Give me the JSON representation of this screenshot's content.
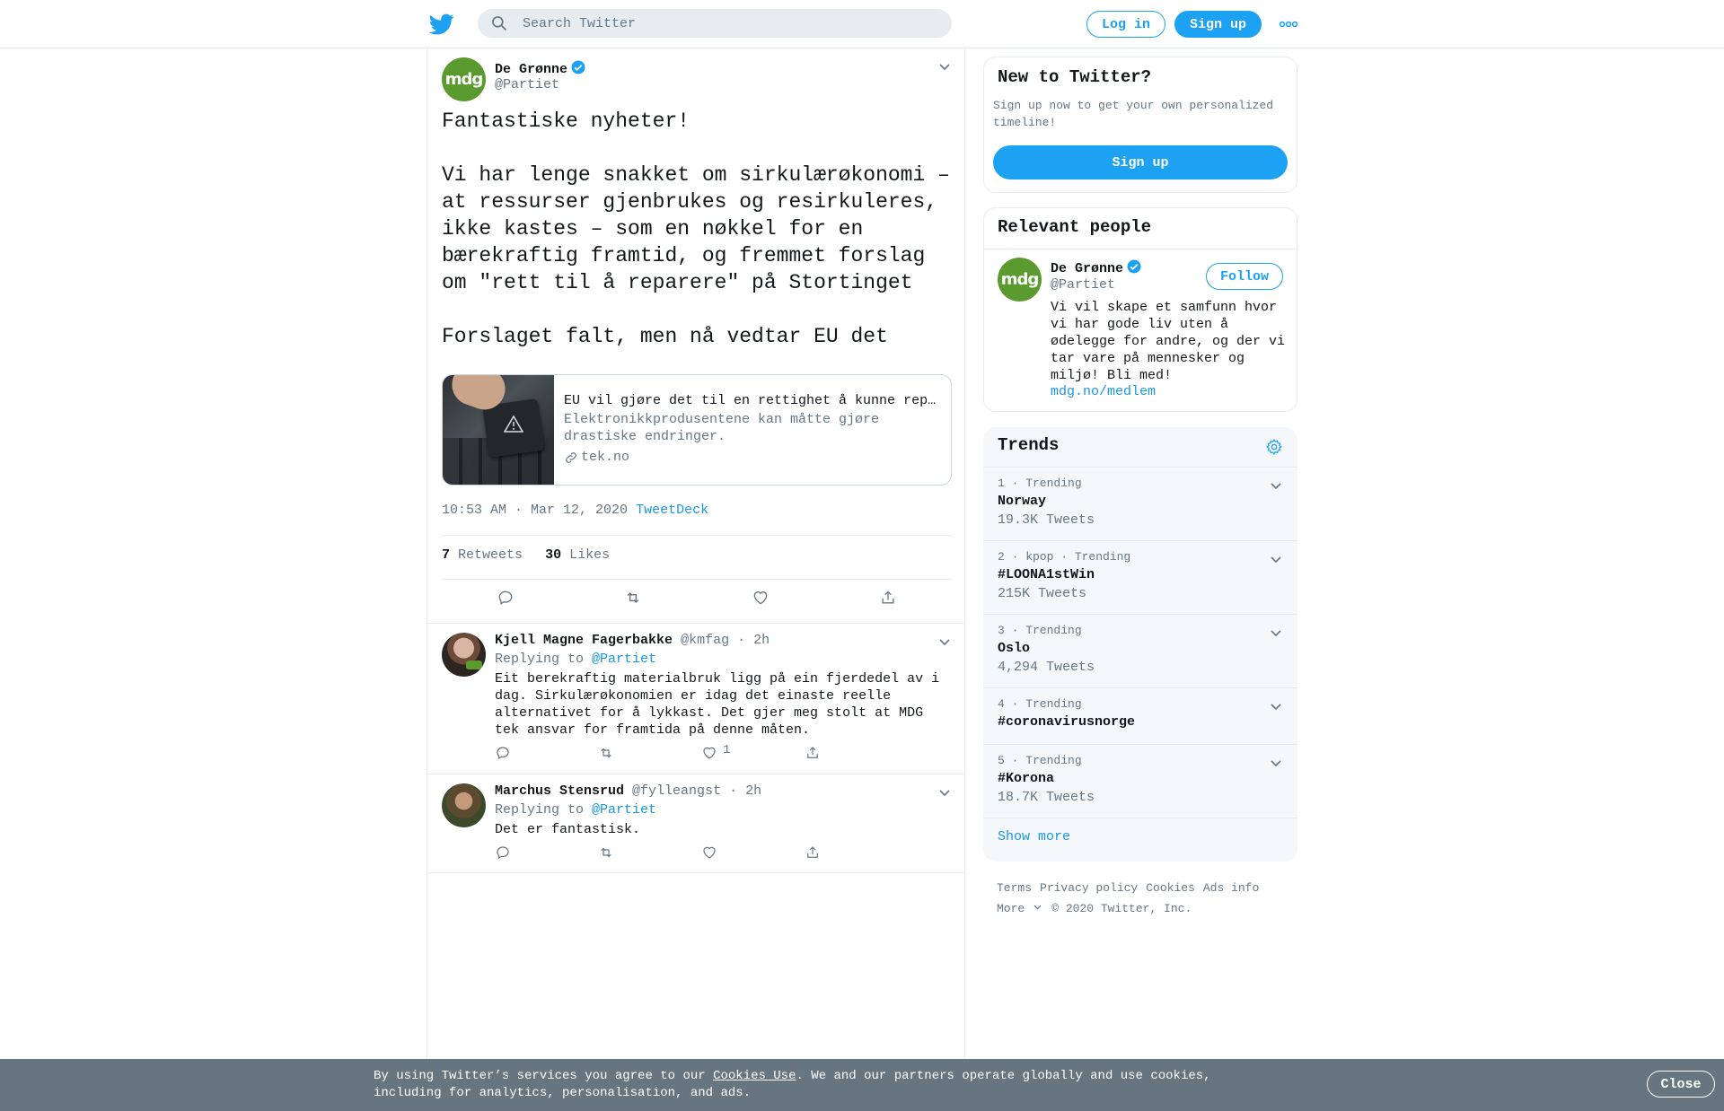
{
  "topbar": {
    "search_placeholder": "Search Twitter",
    "login_label": "Log in",
    "signup_label": "Sign up",
    "more_icon": "more-horizontal-icon"
  },
  "tweet": {
    "avatar_text": "mdg",
    "name": "De Grønne",
    "handle": "@Partiet",
    "text": "Fantastiske nyheter!\n\nVi har lenge snakket om sirkulærøkonomi – at ressurser gjenbrukes og resirkuleres, ikke kastes – som en nøkkel for en bærekraftig framtid, og fremmet forslag om \"rett til å reparere\" på Stortinget\n\nForslaget falt, men nå vedtar EU det",
    "card": {
      "title": "EU vil gjøre det til en rettighet å kunne reparere",
      "description": "Elektronikkprodusentene kan måtte gjøre drastiske endringer.",
      "domain": "tek.no"
    },
    "time": "10:53 AM · Mar 12, 2020",
    "time_sep": "·",
    "source": "TweetDeck",
    "retweets": "7",
    "retweets_label": "Retweets",
    "likes": "30",
    "likes_label": "Likes"
  },
  "replies": [
    {
      "name": "Kjell Magne Fagerbakke",
      "handle": "@kmfag",
      "sep": "·",
      "time": "2h",
      "replying_label": "Replying to",
      "replying_handle": "@Partiet",
      "text": "Eit berekraftig materialbruk ligg på ein fjerdedel av i dag. Sirkulærøkonomien er idag det einaste reelle alternativet for å lykkast. Det gjer meg stolt at MDG tek ansvar for framtida på denne måten.",
      "like_count": "1"
    },
    {
      "name": "Marchus Stensrud",
      "handle": "@fylleangst",
      "sep": "·",
      "time": "2h",
      "replying_label": "Replying to",
      "replying_handle": "@Partiet",
      "text": "Det er fantastisk.",
      "like_count": ""
    }
  ],
  "sidebar": {
    "new_title": "New to Twitter?",
    "new_text": "Sign up now to get your own personalized timeline!",
    "new_signup": "Sign up",
    "relevant_title": "Relevant people",
    "person": {
      "avatar_text": "mdg",
      "name": "De Grønne",
      "handle": "@Partiet",
      "follow_label": "Follow",
      "bio": "Vi vil skape et samfunn hvor vi har gode liv uten å ødelegge for andre, og der vi tar vare på mennesker og miljø! Bli med!",
      "link": "mdg.no/medlem"
    },
    "trends_title": "Trends",
    "trends": [
      {
        "meta": "1 · Trending",
        "name": "Norway",
        "count": "19.3K Tweets"
      },
      {
        "meta": "2 · kpop · Trending",
        "name": "#LOONA1stWin",
        "count": "215K Tweets"
      },
      {
        "meta": "3 · Trending",
        "name": "Oslo",
        "count": "4,294 Tweets"
      },
      {
        "meta": "4 · Trending",
        "name": "#coronavirusnorge",
        "count": ""
      },
      {
        "meta": "5 · Trending",
        "name": "#Korona",
        "count": "18.7K Tweets"
      }
    ],
    "show_more": "Show more"
  },
  "footer": {
    "links": [
      "Terms",
      "Privacy policy",
      "Cookies",
      "Ads info"
    ],
    "more": "More",
    "copyright": "© 2020 Twitter, Inc."
  },
  "cookie": {
    "text_before": "By using Twitter’s services you agree to our ",
    "link": "Cookies Use",
    "text_after": ". We and our partners operate globally and use cookies, including for analytics, personalisation, and ads.",
    "close": "Close"
  },
  "colors": {
    "accent": "#1da1f2",
    "link": "#1b95e0",
    "mdg_green": "#5a9a2e",
    "cookie_bg": "#66757f"
  }
}
